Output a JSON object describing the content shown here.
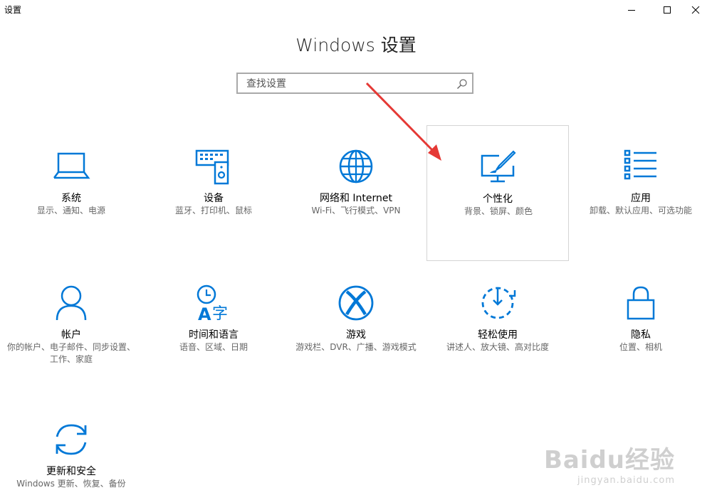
{
  "window": {
    "title": "设置"
  },
  "heading": "Windows 设置",
  "search": {
    "placeholder": "查找设置",
    "value": ""
  },
  "accent_color": "#0078d7",
  "tiles": [
    {
      "icon": "laptop-icon",
      "name": "系统",
      "desc": "显示、通知、电源"
    },
    {
      "icon": "devices-icon",
      "name": "设备",
      "desc": "蓝牙、打印机、鼠标"
    },
    {
      "icon": "globe-icon",
      "name": "网络和 Internet",
      "desc": "Wi-Fi、飞行模式、VPN"
    },
    {
      "icon": "personalization-icon",
      "name": "个性化",
      "desc": "背景、锁屏、颜色"
    },
    {
      "icon": "apps-icon",
      "name": "应用",
      "desc": "卸载、默认应用、可选功能"
    },
    {
      "icon": "person-icon",
      "name": "帐户",
      "desc": "你的帐户、电子邮件、同步设置、工作、家庭"
    },
    {
      "icon": "time-language-icon",
      "name": "时间和语言",
      "desc": "语音、区域、日期"
    },
    {
      "icon": "xbox-icon",
      "name": "游戏",
      "desc": "游戏栏、DVR、广播、游戏模式"
    },
    {
      "icon": "ease-of-access-icon",
      "name": "轻松使用",
      "desc": "讲述人、放大镜、高对比度"
    },
    {
      "icon": "lock-icon",
      "name": "隐私",
      "desc": "位置、相机"
    },
    {
      "icon": "update-icon",
      "name": "更新和安全",
      "desc": "Windows 更新、恢复、备份"
    }
  ],
  "watermark": {
    "brand": "Baidu经验",
    "url": "jingyan.baidu.com"
  }
}
